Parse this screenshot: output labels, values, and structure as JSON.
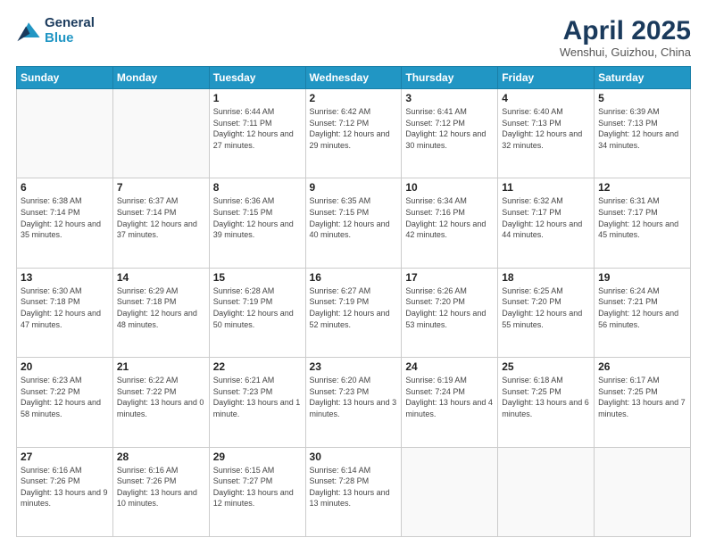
{
  "header": {
    "logo_line1": "General",
    "logo_line2": "Blue",
    "title": "April 2025",
    "location": "Wenshui, Guizhou, China"
  },
  "weekdays": [
    "Sunday",
    "Monday",
    "Tuesday",
    "Wednesday",
    "Thursday",
    "Friday",
    "Saturday"
  ],
  "weeks": [
    [
      {
        "day": "",
        "info": ""
      },
      {
        "day": "",
        "info": ""
      },
      {
        "day": "1",
        "info": "Sunrise: 6:44 AM\nSunset: 7:11 PM\nDaylight: 12 hours and 27 minutes."
      },
      {
        "day": "2",
        "info": "Sunrise: 6:42 AM\nSunset: 7:12 PM\nDaylight: 12 hours and 29 minutes."
      },
      {
        "day": "3",
        "info": "Sunrise: 6:41 AM\nSunset: 7:12 PM\nDaylight: 12 hours and 30 minutes."
      },
      {
        "day": "4",
        "info": "Sunrise: 6:40 AM\nSunset: 7:13 PM\nDaylight: 12 hours and 32 minutes."
      },
      {
        "day": "5",
        "info": "Sunrise: 6:39 AM\nSunset: 7:13 PM\nDaylight: 12 hours and 34 minutes."
      }
    ],
    [
      {
        "day": "6",
        "info": "Sunrise: 6:38 AM\nSunset: 7:14 PM\nDaylight: 12 hours and 35 minutes."
      },
      {
        "day": "7",
        "info": "Sunrise: 6:37 AM\nSunset: 7:14 PM\nDaylight: 12 hours and 37 minutes."
      },
      {
        "day": "8",
        "info": "Sunrise: 6:36 AM\nSunset: 7:15 PM\nDaylight: 12 hours and 39 minutes."
      },
      {
        "day": "9",
        "info": "Sunrise: 6:35 AM\nSunset: 7:15 PM\nDaylight: 12 hours and 40 minutes."
      },
      {
        "day": "10",
        "info": "Sunrise: 6:34 AM\nSunset: 7:16 PM\nDaylight: 12 hours and 42 minutes."
      },
      {
        "day": "11",
        "info": "Sunrise: 6:32 AM\nSunset: 7:17 PM\nDaylight: 12 hours and 44 minutes."
      },
      {
        "day": "12",
        "info": "Sunrise: 6:31 AM\nSunset: 7:17 PM\nDaylight: 12 hours and 45 minutes."
      }
    ],
    [
      {
        "day": "13",
        "info": "Sunrise: 6:30 AM\nSunset: 7:18 PM\nDaylight: 12 hours and 47 minutes."
      },
      {
        "day": "14",
        "info": "Sunrise: 6:29 AM\nSunset: 7:18 PM\nDaylight: 12 hours and 48 minutes."
      },
      {
        "day": "15",
        "info": "Sunrise: 6:28 AM\nSunset: 7:19 PM\nDaylight: 12 hours and 50 minutes."
      },
      {
        "day": "16",
        "info": "Sunrise: 6:27 AM\nSunset: 7:19 PM\nDaylight: 12 hours and 52 minutes."
      },
      {
        "day": "17",
        "info": "Sunrise: 6:26 AM\nSunset: 7:20 PM\nDaylight: 12 hours and 53 minutes."
      },
      {
        "day": "18",
        "info": "Sunrise: 6:25 AM\nSunset: 7:20 PM\nDaylight: 12 hours and 55 minutes."
      },
      {
        "day": "19",
        "info": "Sunrise: 6:24 AM\nSunset: 7:21 PM\nDaylight: 12 hours and 56 minutes."
      }
    ],
    [
      {
        "day": "20",
        "info": "Sunrise: 6:23 AM\nSunset: 7:22 PM\nDaylight: 12 hours and 58 minutes."
      },
      {
        "day": "21",
        "info": "Sunrise: 6:22 AM\nSunset: 7:22 PM\nDaylight: 13 hours and 0 minutes."
      },
      {
        "day": "22",
        "info": "Sunrise: 6:21 AM\nSunset: 7:23 PM\nDaylight: 13 hours and 1 minute."
      },
      {
        "day": "23",
        "info": "Sunrise: 6:20 AM\nSunset: 7:23 PM\nDaylight: 13 hours and 3 minutes."
      },
      {
        "day": "24",
        "info": "Sunrise: 6:19 AM\nSunset: 7:24 PM\nDaylight: 13 hours and 4 minutes."
      },
      {
        "day": "25",
        "info": "Sunrise: 6:18 AM\nSunset: 7:25 PM\nDaylight: 13 hours and 6 minutes."
      },
      {
        "day": "26",
        "info": "Sunrise: 6:17 AM\nSunset: 7:25 PM\nDaylight: 13 hours and 7 minutes."
      }
    ],
    [
      {
        "day": "27",
        "info": "Sunrise: 6:16 AM\nSunset: 7:26 PM\nDaylight: 13 hours and 9 minutes."
      },
      {
        "day": "28",
        "info": "Sunrise: 6:16 AM\nSunset: 7:26 PM\nDaylight: 13 hours and 10 minutes."
      },
      {
        "day": "29",
        "info": "Sunrise: 6:15 AM\nSunset: 7:27 PM\nDaylight: 13 hours and 12 minutes."
      },
      {
        "day": "30",
        "info": "Sunrise: 6:14 AM\nSunset: 7:28 PM\nDaylight: 13 hours and 13 minutes."
      },
      {
        "day": "",
        "info": ""
      },
      {
        "day": "",
        "info": ""
      },
      {
        "day": "",
        "info": ""
      }
    ]
  ]
}
